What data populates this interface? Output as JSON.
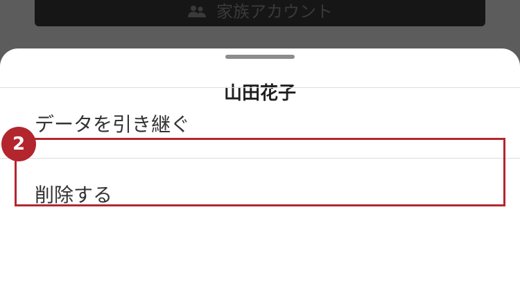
{
  "background": {
    "button_label": "家族アカウント",
    "button_icon": "family-icon"
  },
  "sheet": {
    "title": "山田花子",
    "items": [
      {
        "label": "データを引き継ぐ"
      },
      {
        "label": "削除する"
      }
    ]
  },
  "annotation": {
    "step_number": "2",
    "color": "#b3262d"
  }
}
